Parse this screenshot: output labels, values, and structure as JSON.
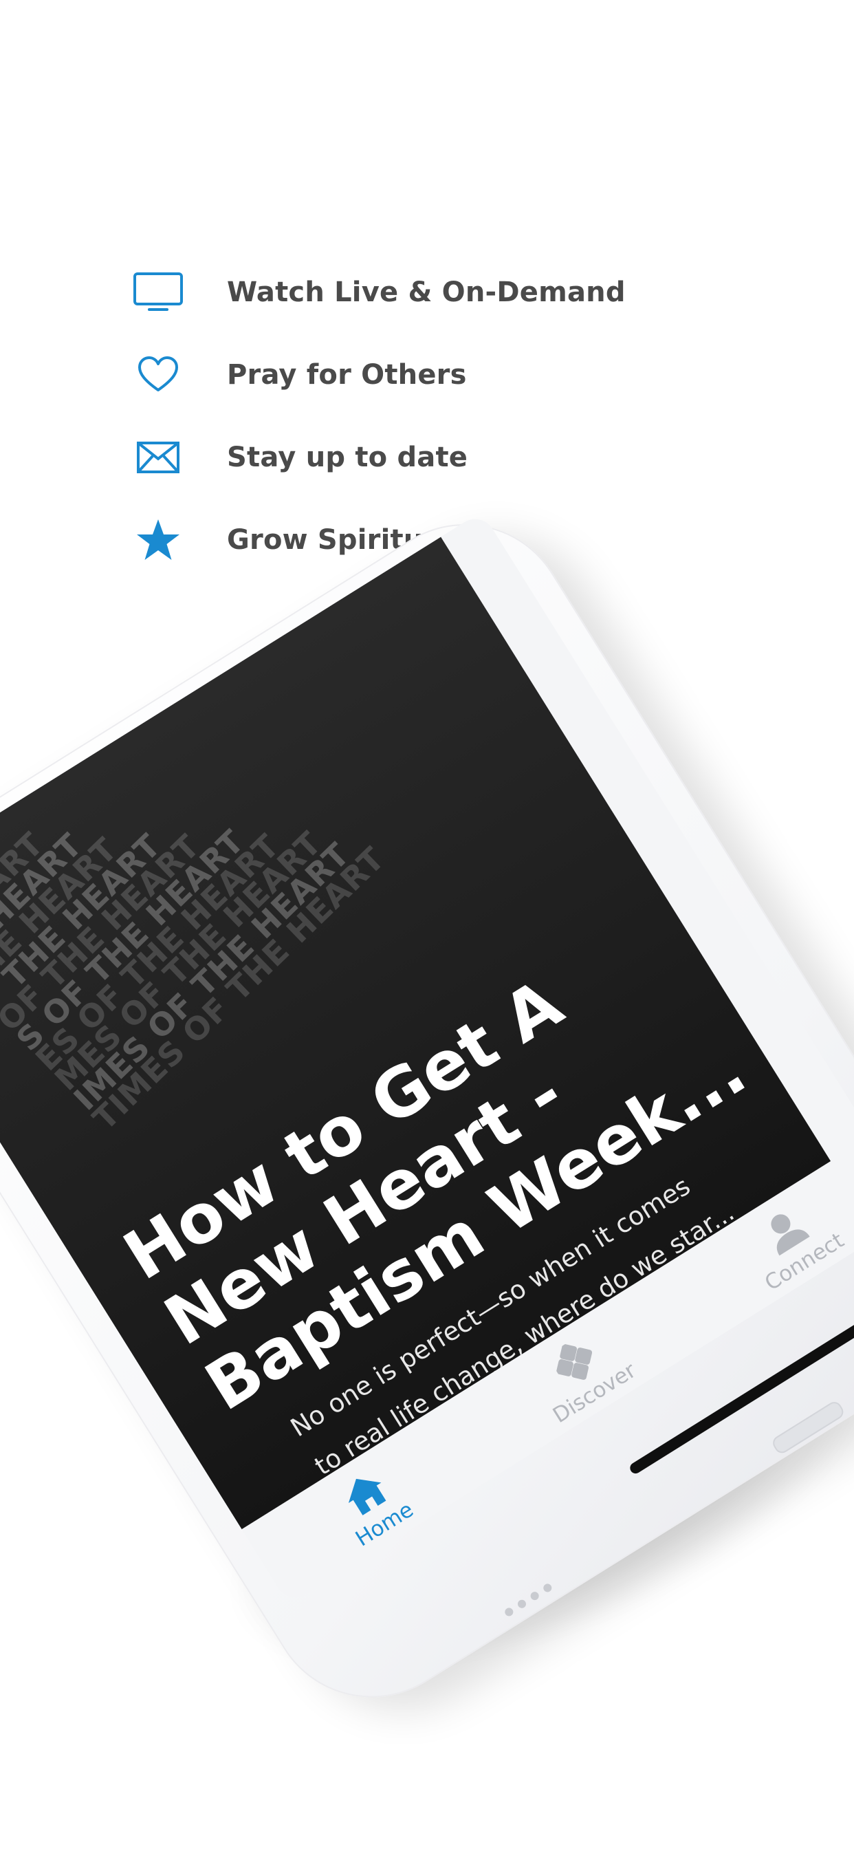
{
  "features": [
    {
      "icon": "tv-icon",
      "label": "Watch Live & On-Demand"
    },
    {
      "icon": "heart-icon",
      "label": "Pray for Others"
    },
    {
      "icon": "envelope-icon",
      "label": "Stay up to date"
    },
    {
      "icon": "star-icon",
      "label": "Grow Spiritually"
    }
  ],
  "colors": {
    "accent": "#1a8ad0",
    "feature_text": "#4a4a4a",
    "tab_inactive": "#b4b7bd",
    "hero_bg": "#1e1e1e"
  },
  "hero": {
    "pattern_lines": [
      "RT",
      "HEART",
      "E HEART",
      "HE HEART",
      "THE HEART",
      "F THE HEART",
      "OF THE HEART",
      "S OF THE HEART",
      "ES OF THE HEART",
      "MES OF THE HEART",
      "IMES OF THE HEART",
      "TIMES OF THE HEART"
    ],
    "title_lines": [
      "How to Get A",
      "New Heart -",
      "Baptism Week..."
    ],
    "description_lines": [
      "No one is perfect—so when it comes",
      "to real life change, where do we star..."
    ]
  },
  "tabs": [
    {
      "icon": "home-icon",
      "label": "Home",
      "active": true
    },
    {
      "icon": "discover-icon",
      "label": "Discover",
      "active": false
    },
    {
      "icon": "connect-icon",
      "label": "Connect",
      "active": false
    }
  ]
}
